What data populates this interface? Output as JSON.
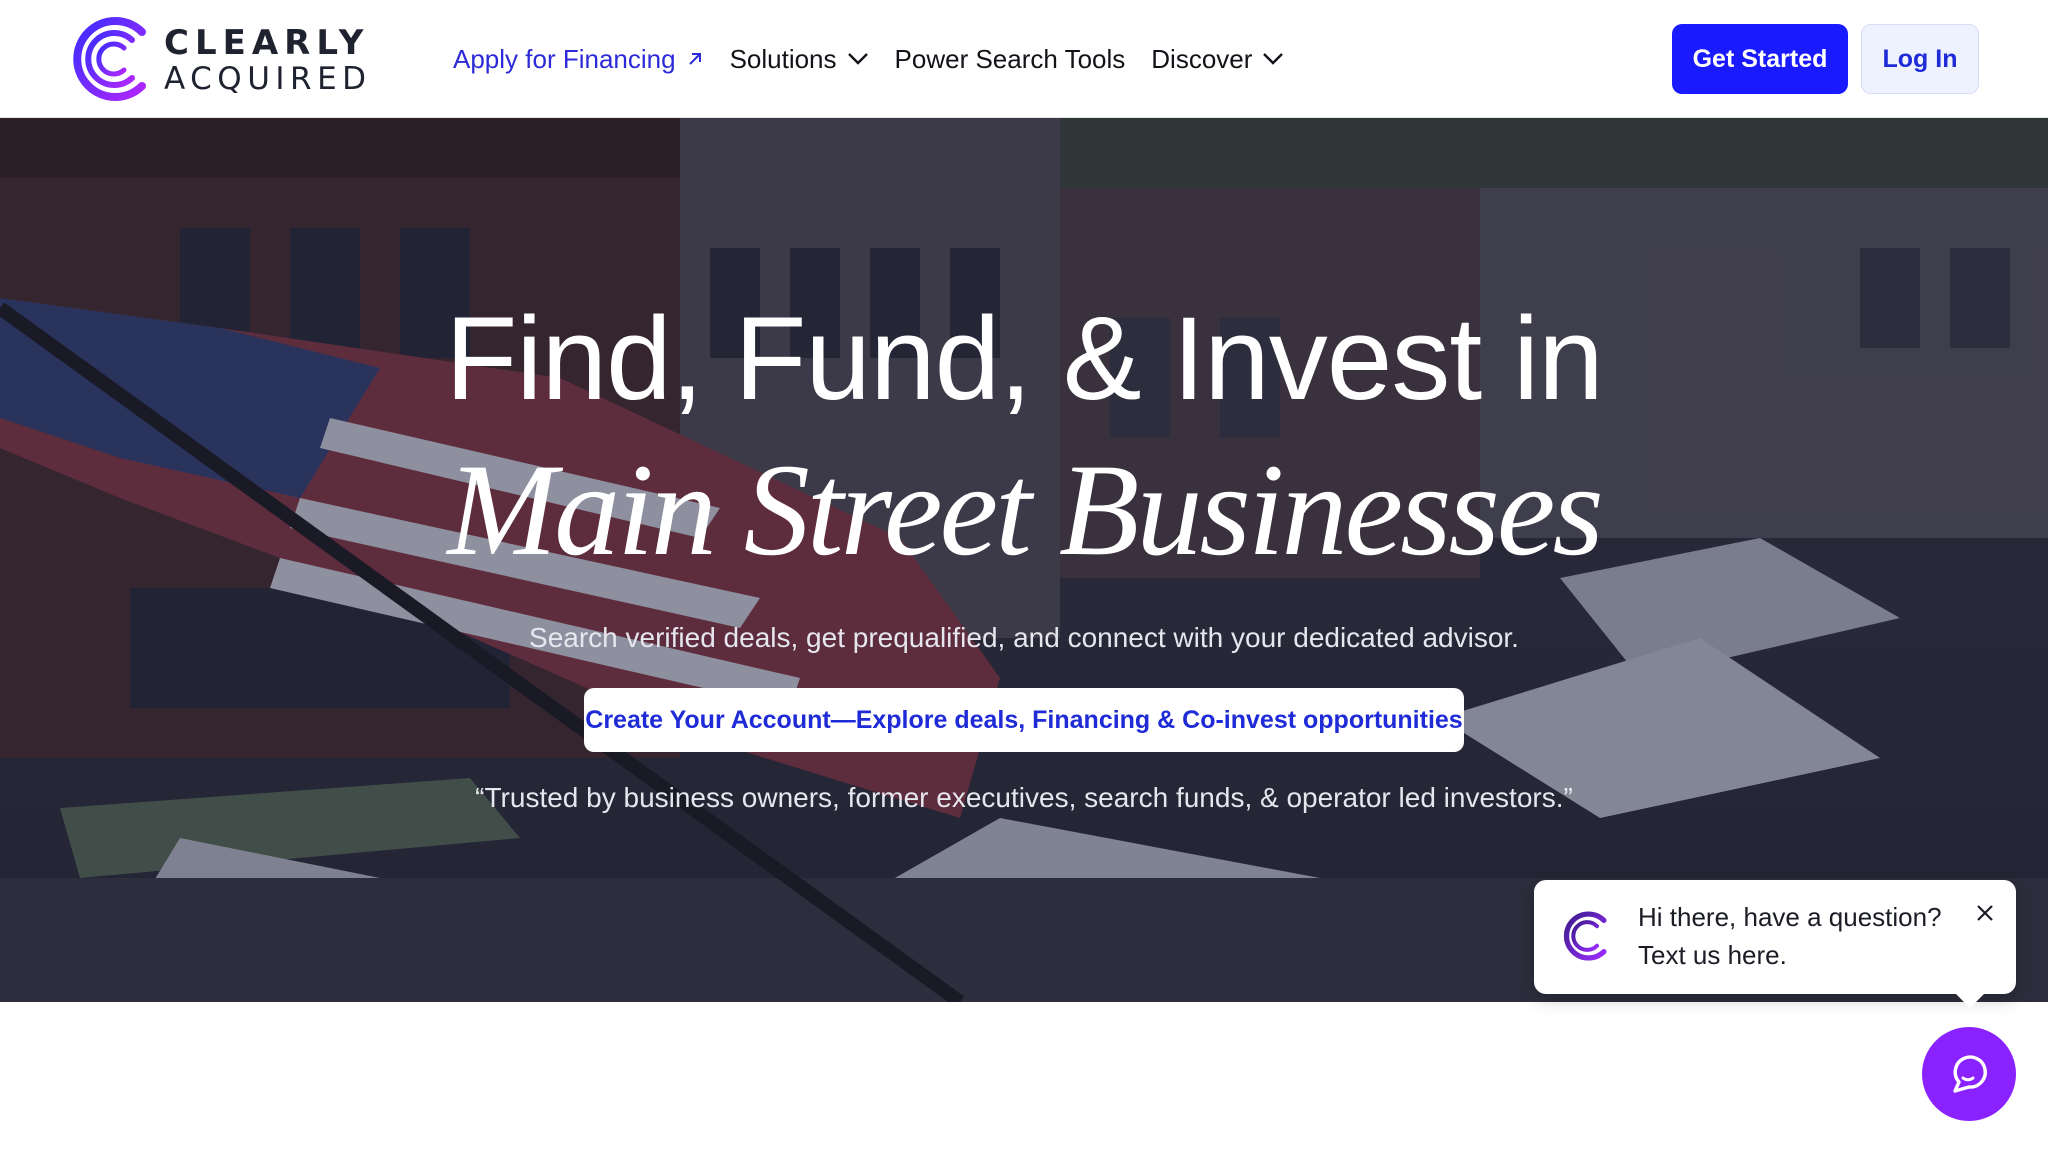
{
  "header": {
    "logo": {
      "line1": "CLEARLY",
      "line2": "ACQUIRED",
      "icon": "clearly-acquired-logo-icon"
    },
    "nav": [
      {
        "label": "Apply for Financing",
        "icon": "arrow-up-right-icon"
      },
      {
        "label": "Solutions",
        "icon": "chevron-down-icon"
      },
      {
        "label": "Power Search Tools"
      },
      {
        "label": "Discover",
        "icon": "chevron-down-icon"
      }
    ],
    "get_started_label": "Get Started",
    "login_label": "Log In"
  },
  "hero": {
    "title_line1": "Find, Fund, & Invest in",
    "title_line2": "Main Street Businesses",
    "subtitle": "Search verified deals, get prequalified, and connect with your dedicated advisor.",
    "cta_label": "Create Your Account—Explore deals, Financing & Co-invest opportunities",
    "quote": "“Trusted by business owners, former executives, search funds, & operator led investors.”"
  },
  "chat": {
    "line1": "Hi there, have a question?",
    "line2": "Text us here.",
    "icons": [
      "close-icon",
      "chat-icon"
    ]
  },
  "colors": {
    "brand_blue": "#1a1aff",
    "nav_accent": "#2d2bd8",
    "chat_purple": "#8a21ff",
    "login_bg": "#eef2ff"
  }
}
